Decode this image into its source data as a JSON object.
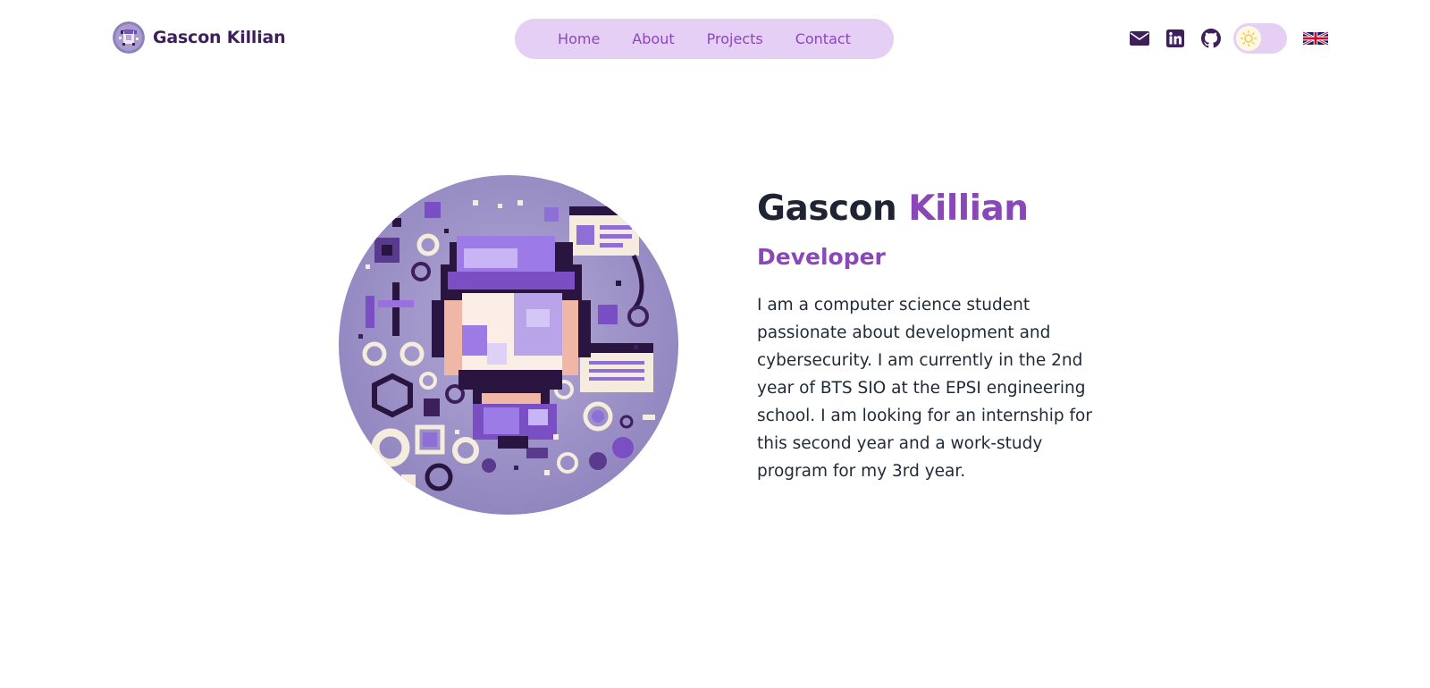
{
  "brand": {
    "name": "Gascon Killian"
  },
  "nav": {
    "home": "Home",
    "about": "About",
    "projects": "Projects",
    "contact": "Contact"
  },
  "header": {
    "icons": [
      "envelope-icon",
      "linkedin-icon",
      "github-icon",
      "sun-icon",
      "uk-flag-icon"
    ],
    "theme": "light"
  },
  "hero": {
    "first_name": "Gascon",
    "last_name": "Killian",
    "role": "Developer",
    "description": "I am a computer science student passionate about development and cybersecurity. I am currently in the 2nd year of BTS SIO at the EPSI engineering school. I am looking for an internship for this second year and a work-study program for my 3rd year."
  },
  "colors": {
    "accent": "#8a47b8",
    "nav_bg": "#e6cff5",
    "brand_text": "#3d1f5c",
    "icon": "#3d1f5c",
    "avatar_bg": "#9d92c4"
  }
}
